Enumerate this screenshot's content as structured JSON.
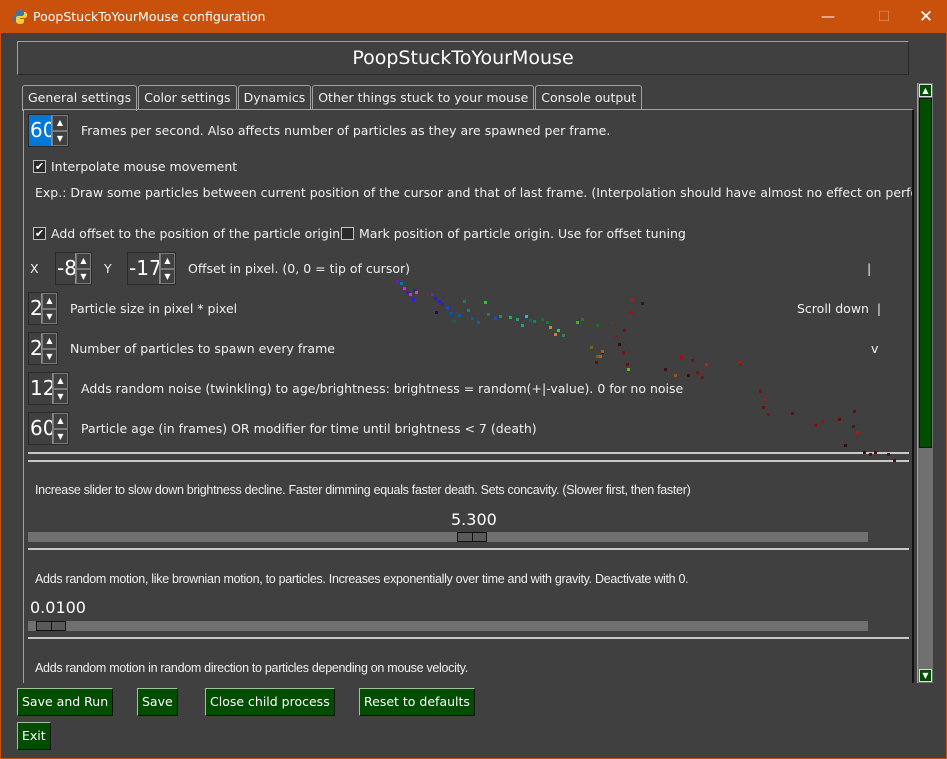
{
  "window": {
    "title": "PoopStuckToYourMouse configuration",
    "controls": {
      "minimize": "—",
      "maximize": "☐",
      "close": "✕"
    }
  },
  "header": {
    "title": "PoopStuckToYourMouse"
  },
  "tabs": [
    {
      "label": "General settings",
      "active": true
    },
    {
      "label": "Color settings",
      "active": false
    },
    {
      "label": "Dynamics",
      "active": false
    },
    {
      "label": "Other things stuck to your mouse",
      "active": false
    },
    {
      "label": "Console output",
      "active": false
    }
  ],
  "general": {
    "fps": {
      "value": "60",
      "label": "Frames per second. Also affects number of particles as they are spawned per frame."
    },
    "interpolate": {
      "checked": true,
      "label": "Interpolate mouse movement"
    },
    "interpolate_explanation": "Exp.: Draw some particles between current position of the cursor and that of last frame. (Interpolation should have almost no effect on performance)",
    "add_offset": {
      "checked": true,
      "label": "Add offset to the position of the particle origin"
    },
    "mark_origin": {
      "checked": false,
      "label": "Mark position of particle origin. Use for offset tuning"
    },
    "offset": {
      "x_label": "X",
      "x_value": "-8",
      "y_label": "Y",
      "y_value": "-17",
      "label": "Offset in pixel. (0, 0 = tip of cursor)"
    },
    "particle_size": {
      "value": "2",
      "label": "Particle size in pixel * pixel"
    },
    "particles_per_frame": {
      "value": "2",
      "label": "Number of particles to spawn every frame"
    },
    "noise": {
      "value": "12",
      "label": "Adds random noise (twinkling) to age/brightness: brightness = random(+|-value). 0 for no noise"
    },
    "age": {
      "value": "60",
      "label": "Particle age (in frames) OR modifier for time until brightness < 7 (death)"
    },
    "scroll_hint": {
      "line1": "|",
      "line2": "Scroll down  |",
      "line3": "v"
    },
    "brightness_decline": {
      "label": "Increase slider to slow down brightness decline. Faster dimming equals faster death. Sets concavity. (Slower first, then faster)",
      "value": "5.300",
      "position_fraction": 0.53
    },
    "brownian": {
      "label": "Adds random motion, like brownian motion, to particles. Increases exponentially over time and with gravity. Deactivate with 0.",
      "value": "0.0100",
      "position_fraction": 0.01
    },
    "velocity_motion": {
      "label": "Adds random motion in random direction to particles depending on mouse velocity."
    }
  },
  "scrollbar": {
    "position_fraction": 0.0,
    "visible_fraction": 0.6
  },
  "buttons": {
    "save_and_run": "Save and Run",
    "save": "Save",
    "close_child": "Close child process",
    "reset": "Reset to defaults",
    "exit": "Exit"
  },
  "icons": {
    "check": "✔",
    "up": "▲",
    "down": "▼"
  }
}
